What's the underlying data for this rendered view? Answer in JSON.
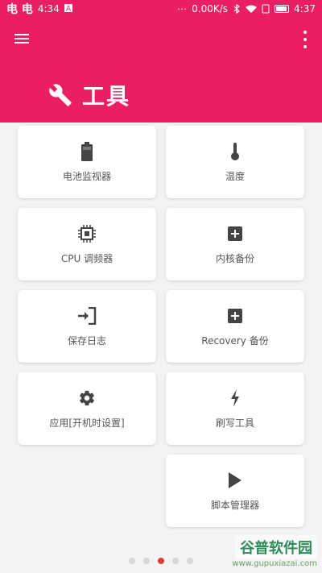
{
  "status_bar": {
    "time_left": "4:34",
    "glyphs_left": "电 电",
    "speed": "0.00K/s",
    "time_right": "4:37"
  },
  "header": {
    "title": "工具",
    "accent_color": "#e91e63"
  },
  "cards": [
    {
      "label": "电池监视器",
      "icon": "battery-icon"
    },
    {
      "label": "温度",
      "icon": "thermometer-icon"
    },
    {
      "label": "CPU 调频器",
      "icon": "cpu-icon"
    },
    {
      "label": "内核备份",
      "icon": "plus-box-icon"
    },
    {
      "label": "保存日志",
      "icon": "login-icon"
    },
    {
      "label": "Recovery 备份",
      "icon": "plus-box-icon"
    },
    {
      "label": "应用[开机时设置]",
      "icon": "gear-icon"
    },
    {
      "label": "刷写工具",
      "icon": "flash-icon"
    },
    {
      "label": "脚本管理器",
      "icon": "play-icon"
    }
  ],
  "pager": {
    "count": 5,
    "active_index": 2
  },
  "watermark": {
    "main": "谷普软件园",
    "sub": "www.gupuxiazai.com"
  }
}
